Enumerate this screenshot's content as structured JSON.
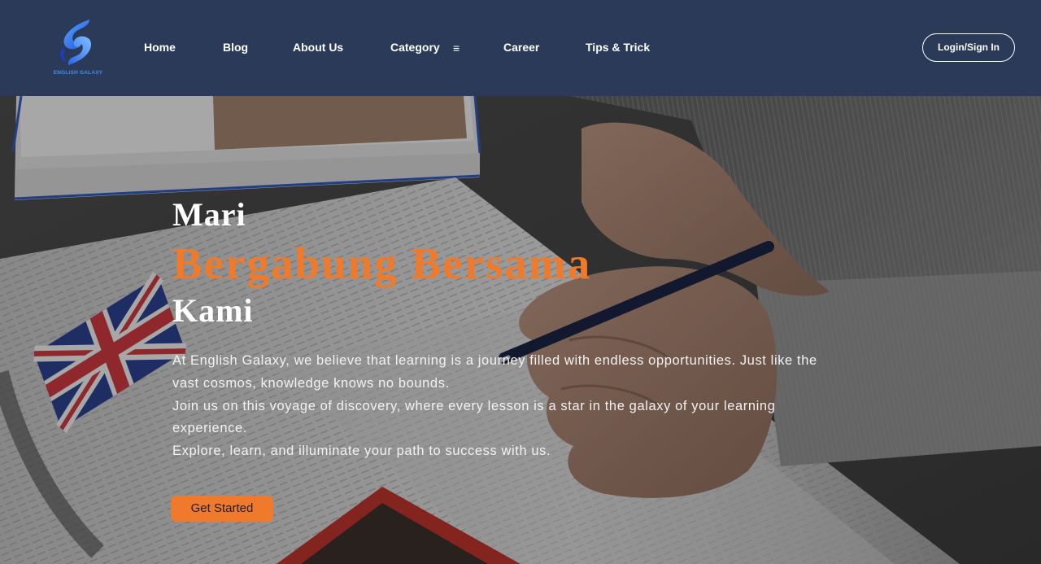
{
  "brand": {
    "name": "ENGLISH GALAXY"
  },
  "nav": {
    "items": [
      {
        "label": "Home"
      },
      {
        "label": "Blog"
      },
      {
        "label": "About Us"
      },
      {
        "label": "Category"
      },
      {
        "label": "Career"
      },
      {
        "label": "Tips & Trick"
      }
    ],
    "category_icon": "≡",
    "login_label": "Login/Sign In"
  },
  "hero": {
    "title_line1": "Mari",
    "title_line2": "Bergabung Bersama",
    "title_line3": "Kami",
    "description": [
      "At English Galaxy, we believe that learning is a journey filled with endless opportunities. Just like the",
      "vast cosmos, knowledge knows no bounds.",
      "Join us on this voyage of discovery, where every lesson is a star in the galaxy of your learning",
      "experience.",
      "Explore, learn, and illuminate your path to success with us."
    ],
    "cta_label": "Get Started"
  },
  "colors": {
    "navbar_bg": "#2b3a58",
    "accent_orange": "#f07a2b",
    "logo_blue": "#3f8ff0",
    "text_white": "#ffffff"
  },
  "icons": {
    "logo": "galaxy-swirl-logo-icon",
    "category": "menu-lines-icon"
  }
}
